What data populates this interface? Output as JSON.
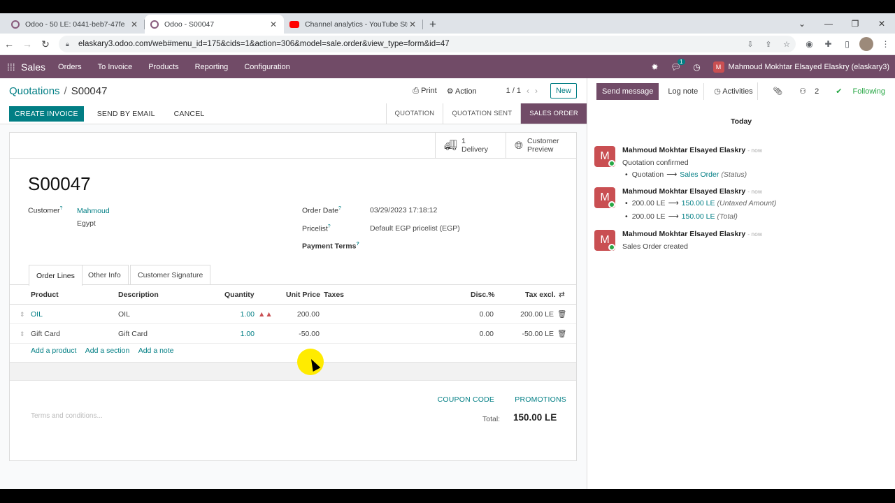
{
  "browser": {
    "tabs": [
      {
        "title": "Odoo - 50 LE: 0441-beb7-47fe",
        "active": false
      },
      {
        "title": "Odoo - S00047",
        "active": true
      },
      {
        "title": "Channel analytics - YouTube Studio",
        "active": false
      }
    ],
    "url": "elaskary3.odoo.com/web#menu_id=175&cids=1&action=306&model=sale.order&view_type=form&id=47"
  },
  "navbar": {
    "app": "Sales",
    "menus": [
      "Orders",
      "To Invoice",
      "Products",
      "Reporting",
      "Configuration"
    ],
    "chat_badge": "1",
    "user_initial": "M",
    "user_name": "Mahmoud Mokhtar Elsayed Elaskry (elaskary3)"
  },
  "control_panel": {
    "breadcrumb_parent": "Quotations",
    "breadcrumb_sep": "/",
    "breadcrumb_current": "S00047",
    "print": "Print",
    "action": "Action",
    "pager": "1 / 1",
    "new": "New"
  },
  "statusbar": {
    "create_invoice": "CREATE INVOICE",
    "send_by_email": "SEND BY EMAIL",
    "cancel": "CANCEL",
    "stages": [
      "QUOTATION",
      "QUOTATION SENT",
      "SALES ORDER"
    ],
    "current_stage": "SALES ORDER"
  },
  "smart_buttons": {
    "delivery_count": "1",
    "delivery_label": "Delivery",
    "preview_line1": "Customer",
    "preview_line2": "Preview"
  },
  "order": {
    "name": "S00047",
    "customer_label": "Customer",
    "customer_name": "Mahmoud",
    "customer_country": "Egypt",
    "order_date_label": "Order Date",
    "order_date": "03/29/2023 17:18:12",
    "pricelist_label": "Pricelist",
    "pricelist": "Default EGP pricelist (EGP)",
    "payment_terms_label": "Payment Terms",
    "help_mark": "?"
  },
  "notebook": {
    "tabs": [
      "Order Lines",
      "Other Info",
      "Customer Signature"
    ]
  },
  "order_lines": {
    "headers": [
      "Product",
      "Description",
      "Quantity",
      "Unit Price",
      "Taxes",
      "Disc.%",
      "Tax excl."
    ],
    "rows": [
      {
        "product": "OIL",
        "description": "OIL",
        "quantity": "1.00",
        "unit_price": "200.00",
        "discount": "0.00",
        "subtotal": "200.00 LE"
      },
      {
        "product": "Gift Card",
        "description": "Gift Card",
        "quantity": "1.00",
        "unit_price": "-50.00",
        "discount": "0.00",
        "subtotal": "-50.00 LE"
      }
    ],
    "add_product": "Add a product",
    "add_section": "Add a section",
    "add_note": "Add a note"
  },
  "footer": {
    "coupon_code": "COUPON CODE",
    "promotions": "PROMOTIONS",
    "terms_placeholder": "Terms and conditions...",
    "total_label": "Total:",
    "total_value": "150.00 LE"
  },
  "chatter": {
    "send_message": "Send message",
    "log_note": "Log note",
    "activities": "Activities",
    "followers_count": "2",
    "following": "Following",
    "today": "Today",
    "messages": [
      {
        "author": "Mahmoud Mokhtar Elsayed Elaskry",
        "when": "- now",
        "text": "Quotation confirmed",
        "tracking_old": "Quotation",
        "tracking_new": "Sales Order",
        "tracking_field": "(Status)"
      },
      {
        "author": "Mahmoud Mokhtar Elsayed Elaskry",
        "when": "- now",
        "t1_old": "200.00 LE",
        "t1_new": "150.00 LE",
        "t1_field": "(Untaxed Amount)",
        "t2_old": "200.00 LE",
        "t2_new": "150.00 LE",
        "t2_field": "(Total)"
      },
      {
        "author": "Mahmoud Mokhtar Elsayed Elaskry",
        "when": "- now",
        "text": "Sales Order created"
      }
    ]
  },
  "colors": {
    "brand": "#714b67",
    "accent": "#017e84"
  }
}
